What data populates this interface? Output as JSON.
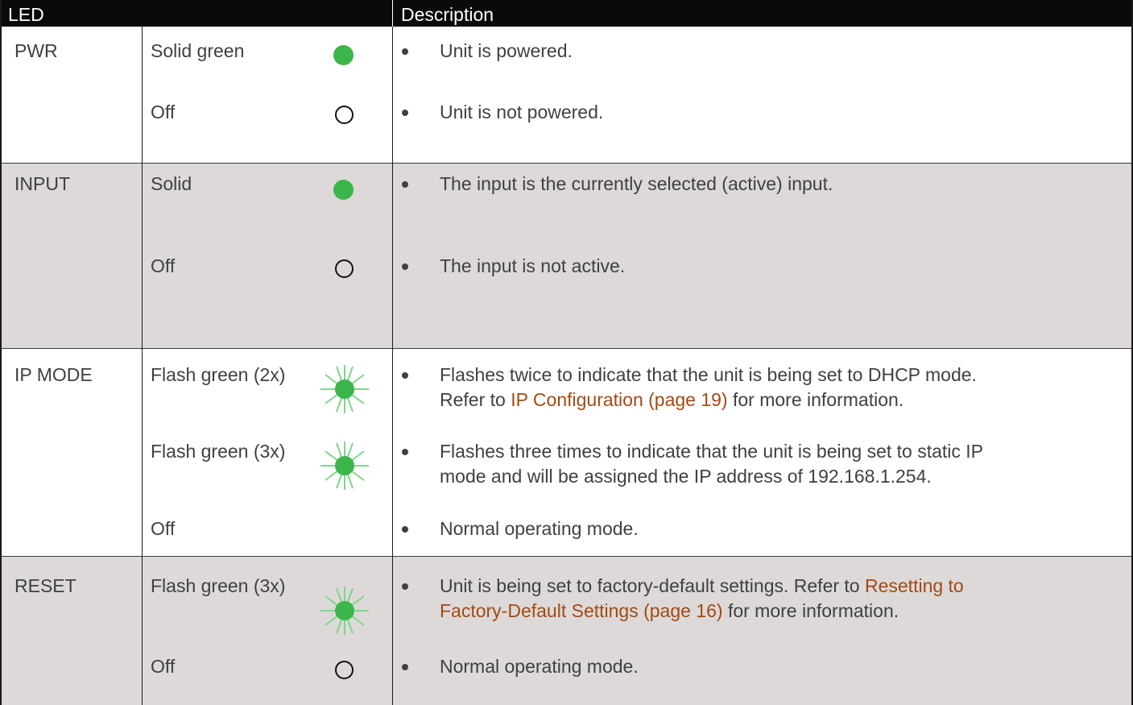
{
  "header": {
    "col_led": "LED",
    "col_description": "Description"
  },
  "rows": {
    "pwr": {
      "name": "PWR",
      "s1": {
        "state": "Solid green",
        "indicator": "solid-dot-icon",
        "desc": "Unit is powered."
      },
      "s2": {
        "state": "Off",
        "indicator": "off-circle-icon",
        "desc": "Unit is not powered."
      }
    },
    "input": {
      "name": "INPUT",
      "s1": {
        "state": "Solid",
        "indicator": "solid-dot-icon",
        "desc": "The input is the currently selected (active) input."
      },
      "s2": {
        "state": "Off",
        "indicator": "off-circle-icon",
        "desc": "The input is not active."
      }
    },
    "ipmode": {
      "name": "IP MODE",
      "s1": {
        "state": "Flash green (2x)",
        "indicator": "flashing-led-icon",
        "line1": "Flashes twice to indicate that the unit is being set to DHCP mode.",
        "line2_pre": "Refer to ",
        "line2_link": "IP Configuration (page 19)",
        "line2_post": " for more information."
      },
      "s2": {
        "state": "Flash green (3x)",
        "indicator": "flashing-led-icon",
        "line1": "Flashes three times to indicate that the unit is being set to static IP",
        "line2": "mode and will be assigned the IP address of 192.168.1.254."
      },
      "s3": {
        "state": "Off",
        "desc": "Normal operating mode."
      }
    },
    "reset": {
      "name": "RESET",
      "s1": {
        "state": "Flash green (3x)",
        "indicator": "flashing-led-icon",
        "line1_pre": "Unit is being set to factory-default settings.  Refer to ",
        "line1_link": "Resetting to",
        "line2_link": "Factory-Default Settings (page 16)",
        "line2_post": " for more information."
      },
      "s2": {
        "state": "Off",
        "indicator": "off-circle-icon",
        "desc": "Normal operating mode."
      }
    }
  },
  "colors": {
    "header_bg": "#0a0a0a",
    "shaded_row": "#ddd9d8",
    "led_green": "#3cb64a",
    "link": "#a24a14",
    "text": "#404040"
  }
}
